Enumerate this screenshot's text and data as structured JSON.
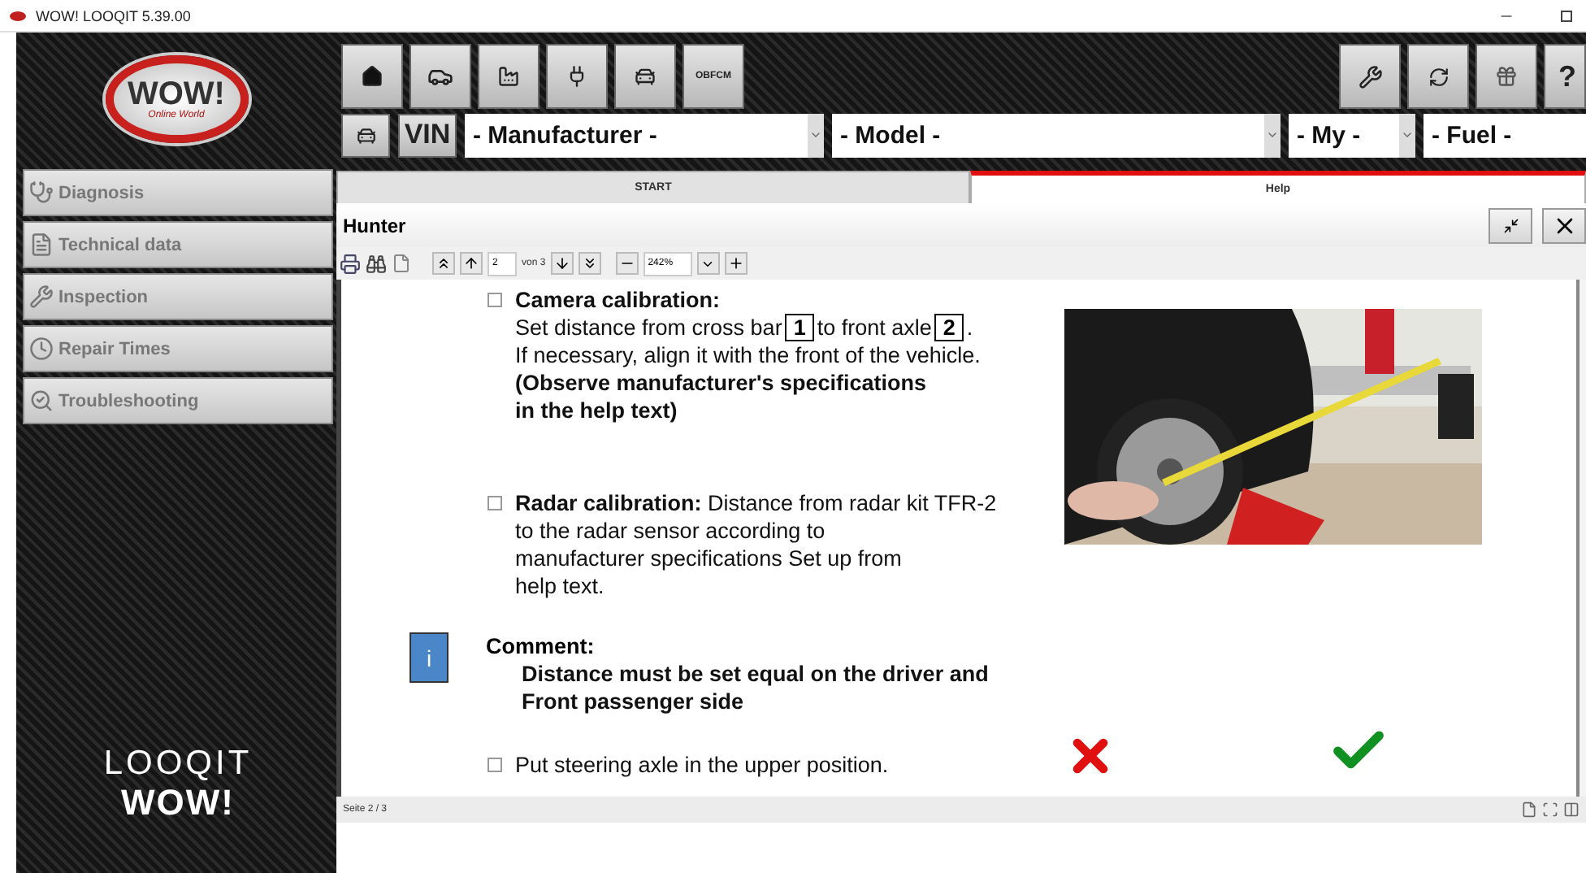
{
  "window": {
    "title": "WOW! LOOQIT 5.39.00"
  },
  "logo": {
    "brand": "WOW!",
    "tagline": "Online World"
  },
  "toolbar": {
    "text_button": "OBFCM",
    "help_button": "?"
  },
  "vehicle": {
    "vin_button": "VIN",
    "manufacturer": "- Manufacturer -",
    "model": "- Model -",
    "year": "- My -",
    "fuel": "- Fuel -"
  },
  "sidebar": {
    "items": [
      {
        "label": "Diagnosis"
      },
      {
        "label": "Technical data"
      },
      {
        "label": "Inspection"
      },
      {
        "label": "Repair Times"
      },
      {
        "label": "Troubleshooting"
      }
    ],
    "footer": {
      "product": "LOOQIT",
      "brand": "WOW!"
    }
  },
  "tabs": [
    {
      "label": "START",
      "selected": false
    },
    {
      "label": "Help",
      "selected": true
    }
  ],
  "panel": {
    "title": "Hunter"
  },
  "pdf_toolbar": {
    "page": "2",
    "of_pages": "von 3",
    "zoom": "242%"
  },
  "document": {
    "blocks": [
      {
        "kind": "step",
        "checked": false,
        "lines": [
          {
            "kind": "bold",
            "text": "Camera calibration:"
          },
          {
            "kind": "parts",
            "parts": [
              {
                "text": "Set distance from cross bar",
                "boxed": false
              },
              {
                "text": "1",
                "boxed": true
              },
              {
                "text": "to front axle",
                "boxed": false
              },
              {
                "text": "2",
                "boxed": true
              },
              {
                "text": ".",
                "boxed": false
              }
            ]
          },
          {
            "kind": "plain",
            "text": "If necessary, align it with the front of the vehicle."
          },
          {
            "kind": "bold",
            "text": "(Observe manufacturer's specifications"
          },
          {
            "kind": "bold",
            "text": "in the help text)"
          }
        ]
      },
      {
        "kind": "step",
        "checked": false,
        "lines": [
          {
            "kind": "plain",
            "text": "**Radar calibration:** Distance from radar kit TFR-2"
          },
          {
            "kind": "plain",
            "text": "to the radar sensor according to"
          },
          {
            "kind": "plain",
            "text": "manufacturer specifications  Set up from"
          },
          {
            "kind": "plain",
            "text": "help text."
          }
        ]
      },
      {
        "kind": "note",
        "icon_text": "i",
        "title": "Comment:",
        "lines": [
          {
            "kind": "bold",
            "text": "Distance must be set equal on the driver and"
          },
          {
            "kind": "bold",
            "text": "Front passenger side"
          }
        ]
      },
      {
        "kind": "step",
        "checked": false,
        "lines": [
          {
            "kind": "plain",
            "text": "Put steering axle in the upper position."
          }
        ]
      }
    ]
  },
  "status_bar": {
    "page": "Seite 2 / 3"
  }
}
